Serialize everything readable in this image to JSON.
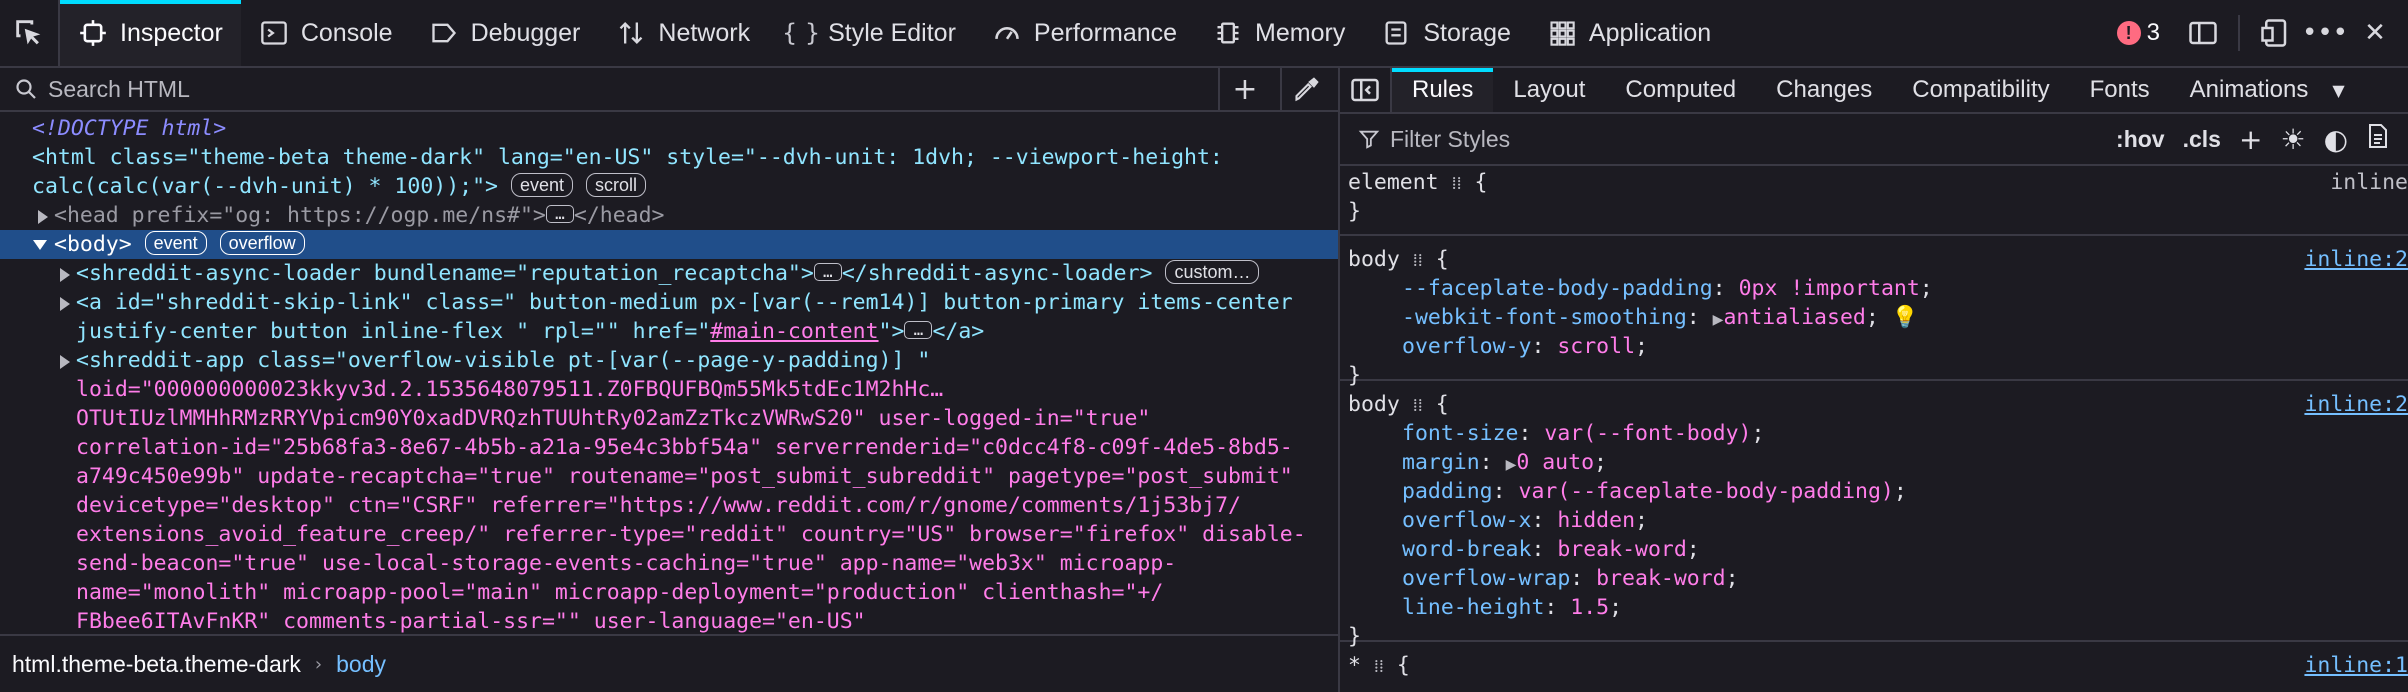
{
  "toolbar": {
    "tabs": [
      {
        "label": "Inspector",
        "icon": "inspector-icon"
      },
      {
        "label": "Console",
        "icon": "console-icon"
      },
      {
        "label": "Debugger",
        "icon": "debugger-icon"
      },
      {
        "label": "Network",
        "icon": "network-icon"
      },
      {
        "label": "Style Editor",
        "icon": "style-editor-icon"
      },
      {
        "label": "Performance",
        "icon": "performance-icon"
      },
      {
        "label": "Memory",
        "icon": "memory-icon"
      },
      {
        "label": "Storage",
        "icon": "storage-icon"
      },
      {
        "label": "Application",
        "icon": "application-icon"
      }
    ],
    "error_count": "3"
  },
  "search": {
    "placeholder": "Search HTML"
  },
  "tree": {
    "doctype": "<!DOCTYPE html>",
    "html_open_1": "<html class=\"theme-beta theme-dark\" lang=\"en-US\" style=\"--dvh-unit: 1dvh; --viewport-height:",
    "html_open_2": "calc(calc(var(--dvh-unit) * 100));\">",
    "html_badges": [
      "event",
      "scroll"
    ],
    "head_line": "<head prefix=\"og: https://ogp.me/ns#\">",
    "head_close": "</head>",
    "body_line": "<body>",
    "body_badges": [
      "event",
      "overflow"
    ],
    "async_loader": "<shreddit-async-loader bundlename=\"reputation_recaptcha\">",
    "async_loader_close": "</shreddit-async-loader>",
    "async_loader_badge": "custom…",
    "skip_link_1": "<a id=\"shreddit-skip-link\" class=\" button-medium px-[var(--rem14)] button-primary items-center",
    "skip_link_2a": "justify-center button inline-flex \" rpl=\"\" href=\"",
    "skip_link_href": "#main-content",
    "skip_link_2b": "\">",
    "skip_link_close": "</a>",
    "app_lines": [
      "<shreddit-app class=\"overflow-visible pt-[var(--page-y-padding)] \"",
      "loid=\"000000000023kkyv3d.2.1535648079511.Z0FBQUFBQm55Mk5tdEc1M2hHc…",
      "OTUtIUzlMMHhRMzRRYVpicm90Y0xadDVRQzhTUUhtRy02amZzTkczVWRwS20\" user-logged-in=\"true\"",
      "correlation-id=\"25b68fa3-8e67-4b5b-a21a-95e4c3bbf54a\" serverrenderid=\"c0dcc4f8-c09f-4de5-8bd5-",
      "a749c450e99b\" update-recaptcha=\"true\" routename=\"post_submit_subreddit\" pagetype=\"post_submit\"",
      "devicetype=\"desktop\" ctn=\"CSRF\" referrer=\"https://www.reddit.com/r/gnome/comments/1j53bj7/",
      "extensions_avoid_feature_creep/\" referrer-type=\"reddit\" country=\"US\" browser=\"firefox\" disable-",
      "send-beacon=\"true\" use-local-storage-events-caching=\"true\" app-name=\"web3x\" microapp-",
      "name=\"monolith\" microapp-pool=\"main\" microapp-deployment=\"production\" clienthash=\"+/",
      "FBbee6ITAvFnKR\" comments-partial-ssr=\"\" user-language=\"en-US\""
    ]
  },
  "breadcrumb": {
    "first": "html.theme-beta.theme-dark",
    "current": "body"
  },
  "rules_panel": {
    "tabs": [
      "Rules",
      "Layout",
      "Computed",
      "Changes",
      "Compatibility",
      "Fonts",
      "Animations"
    ],
    "filter_placeholder": "Filter Styles",
    "hov": ":hov",
    "cls": ".cls",
    "element_rule": {
      "selector": "element",
      "source": "inline"
    },
    "body_rule_1": {
      "selector": "body",
      "source": "inline:2",
      "decls": [
        {
          "prop": "--faceplate-body-padding",
          "value": "0px !important"
        },
        {
          "prop": "-webkit-font-smoothing",
          "value": "antialiased"
        },
        {
          "prop": "overflow-y",
          "value": "scroll"
        }
      ]
    },
    "body_rule_2": {
      "selector": "body",
      "source": "inline:2",
      "decls": [
        {
          "prop": "font-size",
          "value": "var(--font-body)"
        },
        {
          "prop": "margin",
          "value": "0 auto"
        },
        {
          "prop": "padding",
          "value": "var(--faceplate-body-padding)"
        },
        {
          "prop": "overflow-x",
          "value": "hidden"
        },
        {
          "prop": "word-break",
          "value": "break-word"
        },
        {
          "prop": "overflow-wrap",
          "value": "break-word"
        },
        {
          "prop": "line-height",
          "value": "1.5"
        }
      ]
    },
    "star_rule": {
      "selector": "*",
      "source": "inline:1"
    }
  }
}
